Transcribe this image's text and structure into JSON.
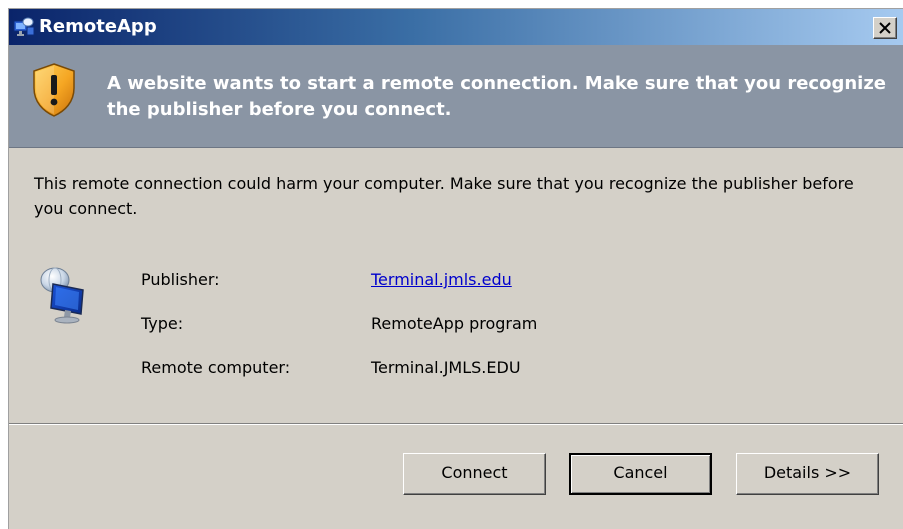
{
  "window": {
    "title": "RemoteApp",
    "close_glyph": "✕"
  },
  "header": {
    "message": "A website wants to start a remote connection. Make sure that you recognize the publisher before you connect."
  },
  "body": {
    "warning": "This remote connection could harm your computer. Make sure that you recognize the publisher before you connect."
  },
  "details": {
    "publisher_label": "Publisher:",
    "publisher_value": "Terminal.jmls.edu",
    "type_label": "Type:",
    "type_value": "RemoteApp program",
    "remote_label": "Remote computer:",
    "remote_value": "Terminal.JMLS.EDU"
  },
  "buttons": {
    "connect": "Connect",
    "cancel": "Cancel",
    "details": "Details >>"
  },
  "icons": {
    "title": "remoteapp-icon",
    "header": "warning-shield-icon",
    "connection": "remote-desktop-icon",
    "close": "close-icon"
  },
  "colors": {
    "dialog_bg": "#d4d0c8",
    "header_band": "#8a95a4",
    "title_gradient_start": "#0a246a",
    "title_gradient_end": "#a6caf0",
    "link": "#0000cc"
  }
}
